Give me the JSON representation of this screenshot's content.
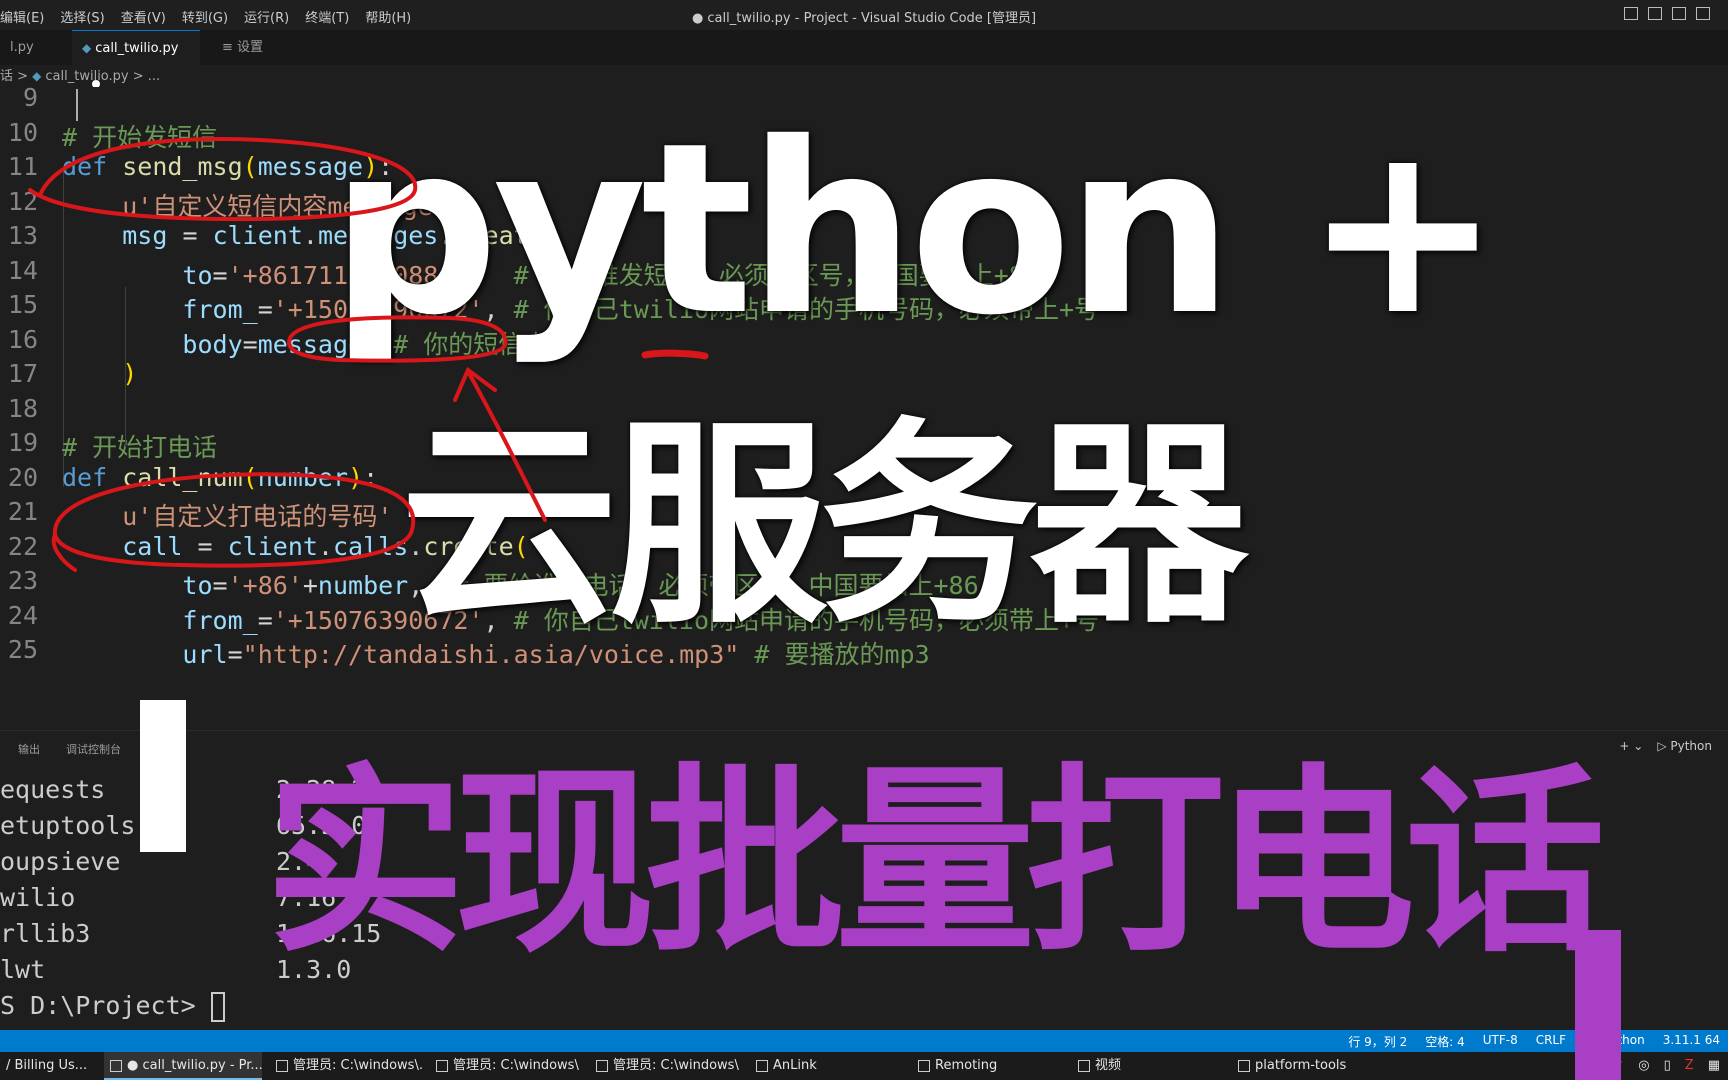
{
  "window": {
    "title": "● call_twilio.py - Project - Visual Studio Code [管理员]",
    "menus": [
      "编辑(E)",
      "选择(S)",
      "查看(V)",
      "转到(G)",
      "运行(R)",
      "终端(T)",
      "帮助(H)"
    ]
  },
  "tabs": [
    {
      "label": "l.py"
    },
    {
      "label": "call_twilio.py",
      "modified": true
    },
    {
      "label": "设置"
    }
  ],
  "breadcrumb": {
    "prefix": "话 >",
    "file": "call_twilio.py",
    "suffix": "> ..."
  },
  "code_lines": [
    {
      "num": "9",
      "html": ""
    },
    {
      "num": "10",
      "html": "<span class=\"cmt\"># 开始发短信</span>"
    },
    {
      "num": "11",
      "html": "<span class=\"kw\">def</span> <span class=\"fn\">send_msg</span><span class=\"br\">(</span><span class=\"var\">message</span><span class=\"br\">)</span><span class=\"op\">:</span>"
    },
    {
      "num": "12",
      "html": "    <span class=\"str\">u'自定义短信内容message'</span>"
    },
    {
      "num": "13",
      "html": "    <span class=\"var\">msg</span> <span class=\"op\">=</span> <span class=\"var\">client</span>.<span class=\"var\">messages</span>.<span class=\"fn\">create</span><span class=\"br\">(</span>"
    },
    {
      "num": "14",
      "html": "        <span class=\"var\">to</span><span class=\"op\">=</span><span class=\"str\">'+8617112600884'</span><span class=\"op\">,</span>  <span class=\"cmt\"># 要给谁发短信，必须带区号，中国要加上+86</span>"
    },
    {
      "num": "15",
      "html": "        <span class=\"var\">from_</span><span class=\"op\">=</span><span class=\"str\">'+15076390672'</span><span class=\"op\">,</span> <span class=\"cmt\"># 你自己twilio网站申请的手机号码，必须带上+号</span>"
    },
    {
      "num": "16",
      "html": "        <span class=\"var\">body</span><span class=\"op\">=</span><span class=\"var\">message</span>  <span class=\"cmt\"># 你的短信内容</span>"
    },
    {
      "num": "17",
      "html": "    <span class=\"br\">)</span>"
    },
    {
      "num": "18",
      "html": ""
    },
    {
      "num": "19",
      "html": "<span class=\"cmt\"># 开始打电话</span>"
    },
    {
      "num": "20",
      "html": "<span class=\"kw\">def</span> <span class=\"fn\">call_num</span><span class=\"br\">(</span><span class=\"var\">number</span><span class=\"br\">)</span><span class=\"op\">:</span>"
    },
    {
      "num": "21",
      "html": "    <span class=\"str\">u'自定义打电话的号码'</span>"
    },
    {
      "num": "22",
      "html": "    <span class=\"var\">call</span> <span class=\"op\">=</span> <span class=\"var\">client</span>.<span class=\"var\">calls</span>.<span class=\"fn\">create</span><span class=\"br\">(</span>"
    },
    {
      "num": "23",
      "html": "        <span class=\"var\">to</span><span class=\"op\">=</span><span class=\"str\">'+86'</span><span class=\"op\">+</span><span class=\"var\">number</span><span class=\"op\">,</span>  <span class=\"cmt\"># 要给谁打电话，必须带区号，中国要加上+86</span>"
    },
    {
      "num": "24",
      "html": "        <span class=\"var\">from_</span><span class=\"op\">=</span><span class=\"str\">'+15076390672'</span><span class=\"op\">,</span> <span class=\"cmt\"># 你自己twilio网站申请的手机号码，必须带上+号</span>"
    },
    {
      "num": "25",
      "html": "        <span class=\"var\">url</span><span class=\"op\">=</span><span class=\"str\">\"http://tandaishi.asia/voice.mp3\"</span> <span class=\"cmt\"># 要播放的mp3</span>"
    }
  ],
  "panel": {
    "tabs": [
      "输出",
      "调试控制台"
    ],
    "shell": "Python",
    "terminal_rows": [
      {
        "name": "equests",
        "version": "2.28.2"
      },
      {
        "name": "etuptools",
        "version": "65.5.0"
      },
      {
        "name": "oupsieve",
        "version": "2.4"
      },
      {
        "name": "wilio",
        "version": "7.16.5"
      },
      {
        "name": "rllib3",
        "version": "1.26.15"
      },
      {
        "name": "lwt",
        "version": "1.3.0"
      }
    ],
    "prompt": "S D:\\Project> "
  },
  "statusbar": {
    "position": "行 9，列 2",
    "spaces": "空格: 4",
    "encoding": "UTF-8",
    "eol": "CRLF",
    "language": "Python",
    "interpreter": "3.11.1 64"
  },
  "taskbar": {
    "items": [
      {
        "label": "/ Billing Us..."
      },
      {
        "label": "● call_twilio.py - Pr...",
        "active": true
      },
      {
        "label": "管理员: C:\\windows\\..."
      },
      {
        "label": "管理员: C:\\windows\\..."
      },
      {
        "label": "管理员: C:\\windows\\..."
      },
      {
        "label": "AnLink"
      },
      {
        "label": "Remoting"
      },
      {
        "label": "视频"
      },
      {
        "label": "platform-tools"
      }
    ]
  },
  "overlay": {
    "title": "python +",
    "subtitle": "云服务器",
    "caption": "实现批量打电话",
    "caption_color": "#a93fc4"
  }
}
